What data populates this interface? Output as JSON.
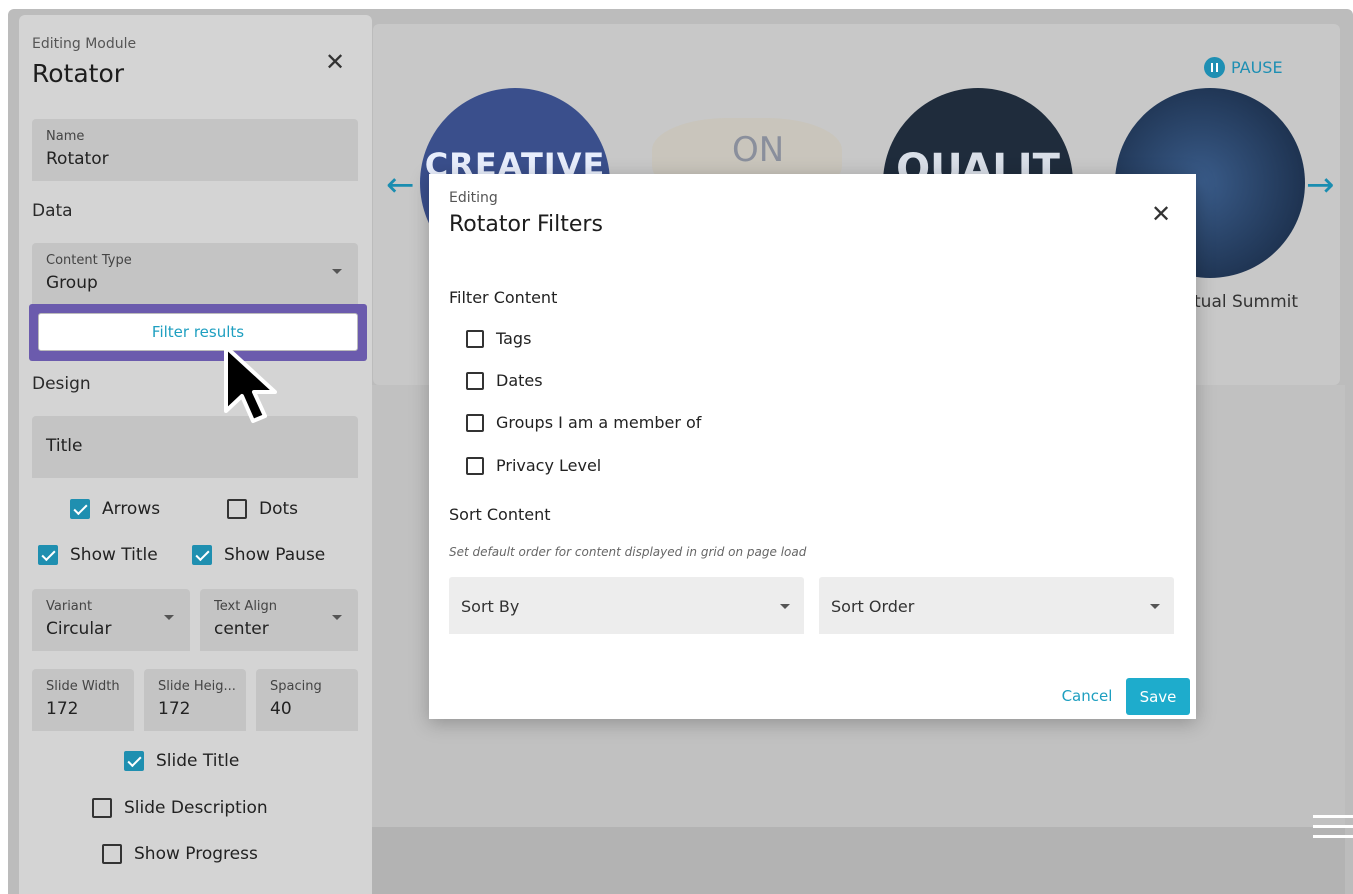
{
  "panel": {
    "eyebrow": "Editing Module",
    "title": "Rotator",
    "name_field": {
      "label": "Name",
      "value": "Rotator"
    },
    "data_section": "Data",
    "content_type": {
      "label": "Content Type",
      "value": "Group"
    },
    "filter_button": "Filter results",
    "design_section": "Design",
    "title_field": {
      "value": "Title"
    },
    "checkboxes": {
      "arrows": {
        "label": "Arrows",
        "checked": true
      },
      "dots": {
        "label": "Dots",
        "checked": false
      },
      "show_title": {
        "label": "Show Title",
        "checked": true
      },
      "show_pause": {
        "label": "Show Pause",
        "checked": true
      },
      "slide_title": {
        "label": "Slide Title",
        "checked": true
      },
      "slide_description": {
        "label": "Slide Description",
        "checked": false
      },
      "show_progress": {
        "label": "Show Progress",
        "checked": false
      }
    },
    "variant": {
      "label": "Variant",
      "value": "Circular"
    },
    "text_align": {
      "label": "Text Align",
      "value": "center"
    },
    "slide_width": {
      "label": "Slide Width",
      "value": "172"
    },
    "slide_height": {
      "label": "Slide Heig...",
      "value": "172"
    },
    "spacing": {
      "label": "Spacing",
      "value": "40"
    }
  },
  "preview": {
    "pause_label": "PAUSE",
    "slide_titles": [
      "tual Summit"
    ],
    "slide_image_text": [
      "CREATIVE",
      "ON",
      "QUALIT"
    ]
  },
  "modal": {
    "eyebrow": "Editing",
    "title": "Rotator Filters",
    "filter_section": "Filter Content",
    "filters": [
      "Tags",
      "Dates",
      "Groups I am a member of",
      "Privacy Level"
    ],
    "sort_section": "Sort Content",
    "sort_note": "Set default order for content displayed in grid on page load",
    "sort_by": "Sort By",
    "sort_order": "Sort Order",
    "cancel": "Cancel",
    "save": "Save"
  },
  "colors": {
    "accent": "#1eaccc",
    "highlight": "#6b5bad",
    "overlay": "#bcbcbc"
  }
}
